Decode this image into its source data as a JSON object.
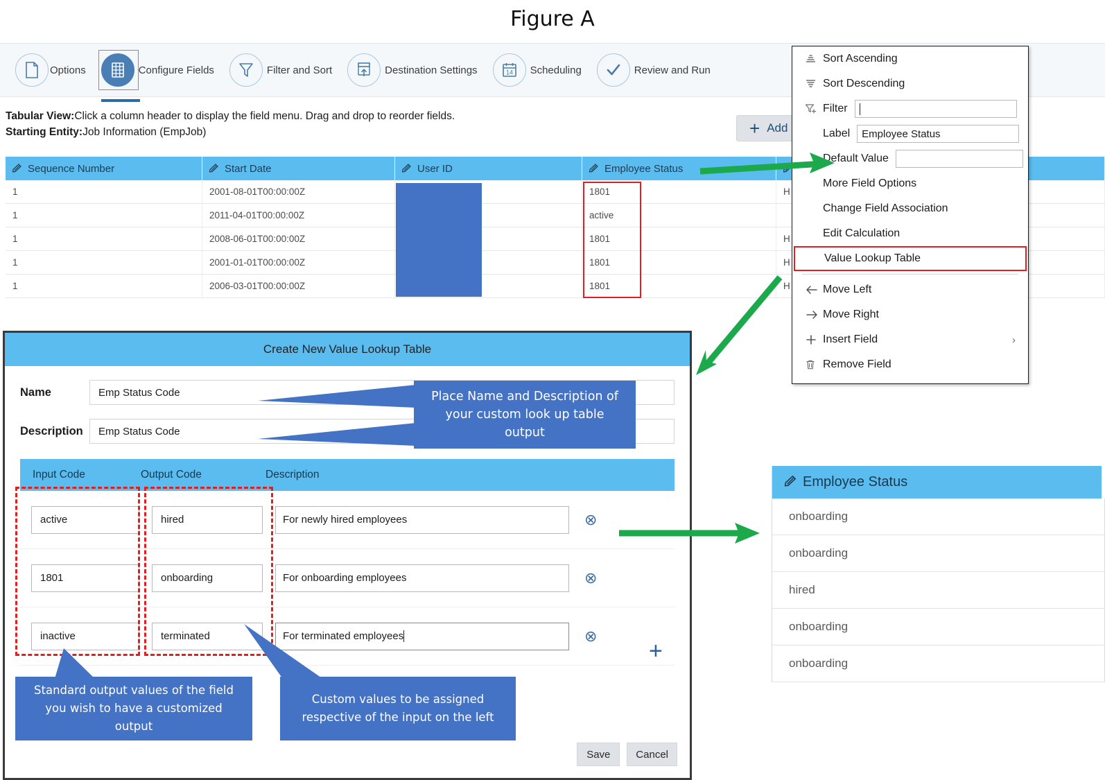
{
  "figure": {
    "title": "Figure A"
  },
  "wizard": {
    "steps": [
      {
        "label": "Options",
        "icon": "document-icon",
        "active": false
      },
      {
        "label": "Configure Fields",
        "icon": "grid-table-icon",
        "active": true
      },
      {
        "label": "Filter and Sort",
        "icon": "funnel-icon",
        "active": false
      },
      {
        "label": "Destination Settings",
        "icon": "export-upload-icon",
        "active": false
      },
      {
        "label": "Scheduling",
        "icon": "calendar-icon",
        "active": false
      },
      {
        "label": "Review and Run",
        "icon": "checkmark-icon",
        "active": false
      }
    ]
  },
  "description": {
    "tabular_view_label": "Tabular View:",
    "tabular_view_text": "Click a column header to display the field menu. Drag and drop to reorder fields.",
    "starting_entity_label": "Starting Entity:",
    "starting_entity_text": "Job Information (EmpJob)"
  },
  "toolbar": {
    "add_label": "Add",
    "add_icon": "plus-icon"
  },
  "grid": {
    "columns": [
      "Sequence Number",
      "Start Date",
      "User ID",
      "Employee Status",
      "",
      ""
    ],
    "rows": [
      {
        "sequence_number": "1",
        "start_date": "2001-08-01T00:00:00Z",
        "user_id": "",
        "employee_status": "1801",
        "col5": "H",
        "col6": ""
      },
      {
        "sequence_number": "1",
        "start_date": "2011-04-01T00:00:00Z",
        "user_id": "",
        "employee_status": "active",
        "col5": "",
        "col6": ""
      },
      {
        "sequence_number": "1",
        "start_date": "2008-06-01T00:00:00Z",
        "user_id": "",
        "employee_status": "1801",
        "col5": "H",
        "col6": ""
      },
      {
        "sequence_number": "1",
        "start_date": "2001-01-01T00:00:00Z",
        "user_id": "",
        "employee_status": "1801",
        "col5": "H",
        "col6": ""
      },
      {
        "sequence_number": "1",
        "start_date": "2006-03-01T00:00:00Z",
        "user_id": "",
        "employee_status": "1801",
        "col5": "H",
        "col6": ""
      }
    ]
  },
  "field_menu": {
    "sort_ascending": "Sort Ascending",
    "sort_descending": "Sort Descending",
    "filter_label": "Filter",
    "filter_value": "",
    "label_label": "Label",
    "label_value": "Employee Status",
    "default_value_label": "Default Value",
    "default_value_value": "",
    "more_field_options": "More Field Options",
    "change_field_association": "Change Field Association",
    "edit_calculation": "Edit Calculation",
    "value_lookup_table": "Value Lookup Table",
    "move_left": "Move Left",
    "move_right": "Move Right",
    "insert_field": "Insert Field",
    "remove_field": "Remove Field"
  },
  "dialog": {
    "title": "Create New Value Lookup Table",
    "name_label": "Name",
    "name_value": "Emp Status Code",
    "description_label": "Description",
    "description_value": "Emp Status Code",
    "table_headers": {
      "input": "Input Code",
      "output": "Output Code",
      "description": "Description"
    },
    "mappings": [
      {
        "input": "active",
        "output": "hired",
        "description": "For newly hired employees"
      },
      {
        "input": "1801",
        "output": "onboarding",
        "description": "For onboarding employees"
      },
      {
        "input": "inactive",
        "output": "terminated",
        "description": "For terminated employees"
      }
    ],
    "save_label": "Save",
    "cancel_label": "Cancel"
  },
  "result_table": {
    "header": "Employee Status",
    "values": [
      "onboarding",
      "onboarding",
      "hired",
      "onboarding",
      "onboarding"
    ]
  },
  "callouts": {
    "name_description": "Place Name and Description of your custom look up table output",
    "standard_output": "Standard output values of the field you wish to have a customized output",
    "custom_values": "Custom values to be assigned respective of the input on the left"
  },
  "colors": {
    "header_blue": "#5bbcf0",
    "callout_blue": "#4472c4",
    "highlight_red": "#e02020",
    "arrow_green": "#1ba94c",
    "accent_blue": "#4a7fb5"
  }
}
